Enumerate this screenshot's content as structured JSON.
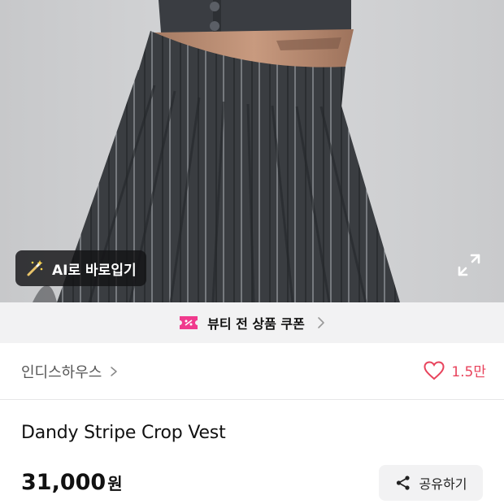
{
  "photo": {
    "ai_button_label": "AI로 바로입기",
    "ai_icon": "magic-wand-icon",
    "expand_icon": "expand-icon"
  },
  "coupon": {
    "label": "뷰티 전 상품 쿠폰",
    "icon": "coupon-percent-icon",
    "accent": "#f03a8d"
  },
  "brand": {
    "name": "인디스하우스",
    "likes": "1.5만",
    "like_color": "#e8435c"
  },
  "product": {
    "title": "Dandy Stripe Crop Vest",
    "price": "31,000",
    "currency": "원"
  },
  "share": {
    "label": "공유하기",
    "icon": "share-icon"
  }
}
